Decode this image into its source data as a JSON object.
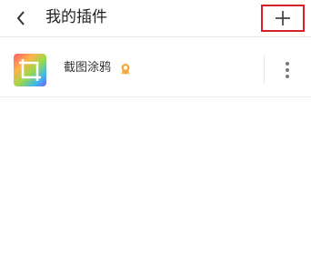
{
  "header": {
    "title": "我的插件",
    "back_icon": "chevron-left-icon",
    "add_icon": "plus-icon"
  },
  "plugins": [
    {
      "name": "截图涂鸦",
      "icon": "crop-icon",
      "badge_icon": "verified-badge-icon",
      "menu_icon": "more-vertical-icon"
    }
  ],
  "colors": {
    "highlight": "#d3202a",
    "badge": "#f2a93b"
  }
}
